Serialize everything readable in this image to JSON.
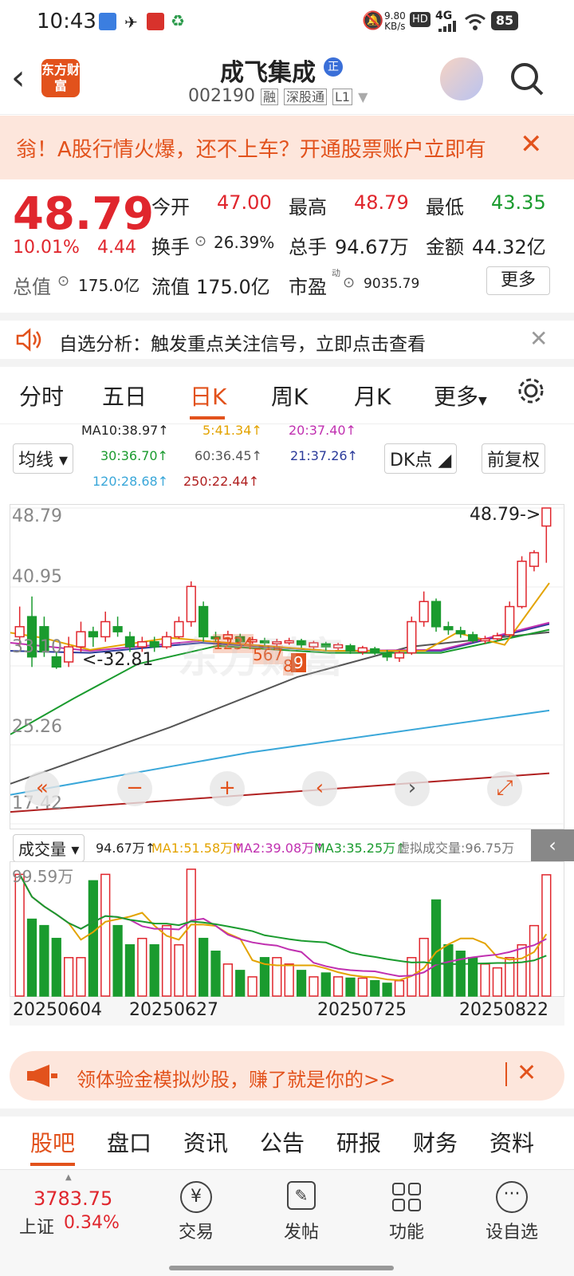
{
  "status": {
    "time": "10:43",
    "net_speed": "9.80",
    "net_unit": "KB/s",
    "hd": "HD",
    "signal": "4G",
    "battery": "85"
  },
  "header": {
    "logo": "东方财富",
    "name": "成飞集成",
    "zheng": "正",
    "code": "002190",
    "tag_rong": "融",
    "tag_sgt": "深股通",
    "tag_l1": "L1"
  },
  "banner": {
    "text": "翁！A股行情火爆，还不上车？开通股票账户立即有"
  },
  "quote": {
    "price": "48.79",
    "pct": "10.01%",
    "change": "4.44",
    "open_label": "今开",
    "open": "47.00",
    "high_label": "最高",
    "high": "48.79",
    "low_label": "最低",
    "low": "43.35",
    "turnover_label": "换手",
    "turnover": "26.39%",
    "vol_label": "总手",
    "vol": "94.67万",
    "amount_label": "金额",
    "amount": "44.32亿",
    "mcap_label": "总值",
    "mcap": "175.0亿",
    "float_label": "流值",
    "float": "175.0亿",
    "pe_label": "市盈",
    "pe_sup": "动",
    "pe": "9035.79",
    "more": "更多"
  },
  "notice": {
    "text": "自选分析：触发重点关注信号，立即点击查看"
  },
  "tabs": [
    "分时",
    "五日",
    "日K",
    "周K",
    "月K",
    "更多"
  ],
  "active_tab": "日K",
  "ma": {
    "ma10": "MA10:38.97↑",
    "ma5": "5:41.34↑",
    "ma20": "20:37.40↑",
    "ma30": "30:36.70↑",
    "ma60": "60:36.45↑",
    "ma21": "21:37.26↑",
    "ma120": "120:28.68↑",
    "ma250": "250:22.44↑",
    "junxian": "均线",
    "dk": "DK点",
    "fq": "前复权"
  },
  "chart": {
    "y_labels": [
      "48.79",
      "40.95",
      "33.10",
      "25.26",
      "17.42"
    ],
    "max_note": "48.79->",
    "min_note": "<-32.81",
    "steps": [
      "1234",
      "567",
      "8",
      "9"
    ],
    "watermark": "东方财富"
  },
  "vol": {
    "selector": "成交量",
    "v": "94.67万↑",
    "ma1": "MA1:51.58万↑",
    "ma2": "MA2:39.08万↑",
    "ma3": "MA3:35.25万↑",
    "virtual": "虚拟成交量:96.75万",
    "top": "99.59万",
    "dates": [
      "20250604",
      "20250627",
      "20250725",
      "20250822"
    ]
  },
  "ad": {
    "text": "领体验金模拟炒股，赚了就是你的>>"
  },
  "btabs": [
    "股吧",
    "盘口",
    "资讯",
    "公告",
    "研报",
    "财务",
    "资料"
  ],
  "bottom": {
    "index_val": "3783.75",
    "index_name": "上证",
    "index_pct": "0.34%",
    "items": [
      "交易",
      "发帖",
      "功能",
      "设自选"
    ]
  },
  "chart_data": {
    "type": "candlestick",
    "y_range": [
      17.42,
      48.79
    ],
    "x_ticks": [
      "20250604",
      "20250627",
      "20250725",
      "20250822"
    ],
    "last_close": 48.79,
    "high": 48.79,
    "low": 43.35,
    "open": 47.0,
    "min_marked": 32.81,
    "ma": {
      "MA5": 41.34,
      "MA10": 38.97,
      "MA20": 37.4,
      "MA21": 37.26,
      "MA30": 36.7,
      "MA60": 36.45,
      "MA120": 28.68,
      "MA250": 22.44
    },
    "volume_max": "99.59万",
    "volume_last": "94.67万"
  },
  "colors": {
    "accent": "#e2521c",
    "up": "#e0262d",
    "down": "#1a9b2e"
  }
}
